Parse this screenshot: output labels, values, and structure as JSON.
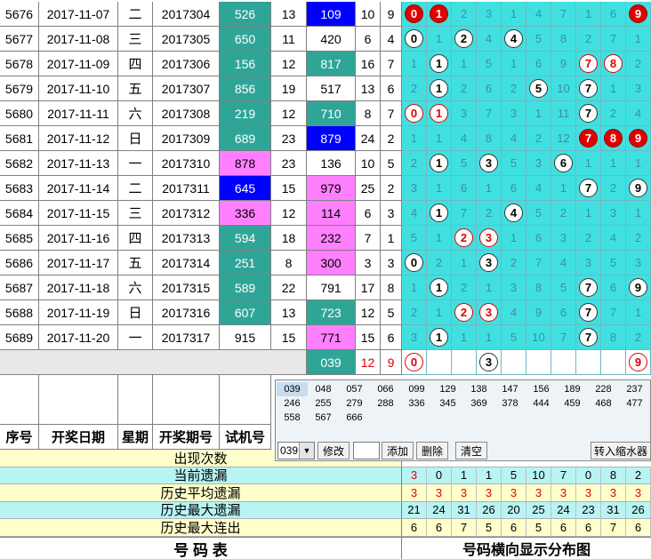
{
  "colors": {
    "teal": "#2fa597",
    "cyan_light": "#aef0f0",
    "blue": "#0000ff",
    "magenta": "#ff80ff",
    "yellow_light": "#ffffcc",
    "grid_bg": "#40e0e0",
    "grey": "#e8e8e8"
  },
  "rows": [
    {
      "seq": "5676",
      "date": "2017-11-07",
      "week": "二",
      "issue": "2017304",
      "trial": "526",
      "trial_bg": "teal",
      "sum": "13",
      "v1": "109",
      "v1_bg": "blue",
      "a": "10",
      "b": "9",
      "dist": [
        [
          "0",
          "red"
        ],
        [
          "1",
          "red"
        ],
        [
          "2",
          ""
        ],
        [
          "3",
          ""
        ],
        [
          "1",
          ""
        ],
        [
          "4",
          ""
        ],
        [
          "7",
          ""
        ],
        [
          "1",
          ""
        ],
        [
          "6",
          ""
        ],
        [
          "9",
          "red"
        ]
      ]
    },
    {
      "seq": "5677",
      "date": "2017-11-08",
      "week": "三",
      "issue": "2017305",
      "trial": "650",
      "trial_bg": "teal",
      "sum": "11",
      "v1": "420",
      "v1_bg": "",
      "a": "6",
      "b": "4",
      "dist": [
        [
          "0",
          "white"
        ],
        [
          "1",
          ""
        ],
        [
          "2",
          "white"
        ],
        [
          "4",
          ""
        ],
        [
          "4",
          "white"
        ],
        [
          "5",
          ""
        ],
        [
          "8",
          ""
        ],
        [
          "2",
          ""
        ],
        [
          "7",
          ""
        ],
        [
          "1",
          ""
        ]
      ]
    },
    {
      "seq": "5678",
      "date": "2017-11-09",
      "week": "四",
      "issue": "2017306",
      "trial": "156",
      "trial_bg": "teal",
      "sum": "12",
      "v1": "817",
      "v1_bg": "teal",
      "a": "16",
      "b": "7",
      "dist": [
        [
          "1",
          ""
        ],
        [
          "1",
          "white"
        ],
        [
          "1",
          ""
        ],
        [
          "5",
          ""
        ],
        [
          "1",
          ""
        ],
        [
          "6",
          ""
        ],
        [
          "9",
          ""
        ],
        [
          "7",
          "redring"
        ],
        [
          "8",
          "redring"
        ],
        [
          "2",
          ""
        ]
      ]
    },
    {
      "seq": "5679",
      "date": "2017-11-10",
      "week": "五",
      "issue": "2017307",
      "trial": "856",
      "trial_bg": "teal",
      "sum": "19",
      "v1": "517",
      "v1_bg": "",
      "a": "13",
      "b": "6",
      "dist": [
        [
          "2",
          ""
        ],
        [
          "1",
          "white"
        ],
        [
          "2",
          ""
        ],
        [
          "6",
          ""
        ],
        [
          "2",
          ""
        ],
        [
          "5",
          "white"
        ],
        [
          "10",
          ""
        ],
        [
          "7",
          "white"
        ],
        [
          "1",
          ""
        ],
        [
          "3",
          ""
        ]
      ]
    },
    {
      "seq": "5680",
      "date": "2017-11-11",
      "week": "六",
      "issue": "2017308",
      "trial": "219",
      "trial_bg": "teal",
      "sum": "12",
      "v1": "710",
      "v1_bg": "teal",
      "a": "8",
      "b": "7",
      "dist": [
        [
          "0",
          "redring"
        ],
        [
          "1",
          "redring"
        ],
        [
          "3",
          ""
        ],
        [
          "7",
          ""
        ],
        [
          "3",
          ""
        ],
        [
          "1",
          ""
        ],
        [
          "11",
          ""
        ],
        [
          "7",
          "white"
        ],
        [
          "2",
          ""
        ],
        [
          "4",
          ""
        ]
      ]
    },
    {
      "seq": "5681",
      "date": "2017-11-12",
      "week": "日",
      "issue": "2017309",
      "trial": "689",
      "trial_bg": "teal",
      "sum": "23",
      "v1": "879",
      "v1_bg": "blue",
      "a": "24",
      "b": "2",
      "dist": [
        [
          "1",
          ""
        ],
        [
          "1",
          ""
        ],
        [
          "4",
          ""
        ],
        [
          "8",
          ""
        ],
        [
          "4",
          ""
        ],
        [
          "2",
          ""
        ],
        [
          "12",
          ""
        ],
        [
          "7",
          "red"
        ],
        [
          "8",
          "red"
        ],
        [
          "9",
          "red"
        ]
      ]
    },
    {
      "seq": "5682",
      "date": "2017-11-13",
      "week": "一",
      "issue": "2017310",
      "trial": "878",
      "trial_bg": "magenta",
      "sum": "23",
      "v1": "136",
      "v1_bg": "",
      "a": "10",
      "b": "5",
      "dist": [
        [
          "2",
          ""
        ],
        [
          "1",
          "white"
        ],
        [
          "5",
          ""
        ],
        [
          "3",
          "white"
        ],
        [
          "5",
          ""
        ],
        [
          "3",
          ""
        ],
        [
          "6",
          "white"
        ],
        [
          "1",
          ""
        ],
        [
          "1",
          ""
        ],
        [
          "1",
          ""
        ]
      ]
    },
    {
      "seq": "5683",
      "date": "2017-11-14",
      "week": "二",
      "issue": "2017311",
      "trial": "645",
      "trial_bg": "blue",
      "sum": "15",
      "v1": "979",
      "v1_bg": "magenta",
      "a": "25",
      "b": "2",
      "dist": [
        [
          "3",
          ""
        ],
        [
          "1",
          ""
        ],
        [
          "6",
          ""
        ],
        [
          "1",
          ""
        ],
        [
          "6",
          ""
        ],
        [
          "4",
          ""
        ],
        [
          "1",
          ""
        ],
        [
          "7",
          "white"
        ],
        [
          "2",
          ""
        ],
        [
          "9",
          "white"
        ]
      ]
    },
    {
      "seq": "5684",
      "date": "2017-11-15",
      "week": "三",
      "issue": "2017312",
      "trial": "336",
      "trial_bg": "magenta",
      "sum": "12",
      "v1": "114",
      "v1_bg": "magenta",
      "a": "6",
      "b": "3",
      "dist": [
        [
          "4",
          ""
        ],
        [
          "1",
          "white"
        ],
        [
          "7",
          ""
        ],
        [
          "2",
          ""
        ],
        [
          "4",
          "white"
        ],
        [
          "5",
          ""
        ],
        [
          "2",
          ""
        ],
        [
          "1",
          ""
        ],
        [
          "3",
          ""
        ],
        [
          "1",
          ""
        ]
      ]
    },
    {
      "seq": "5685",
      "date": "2017-11-16",
      "week": "四",
      "issue": "2017313",
      "trial": "594",
      "trial_bg": "teal",
      "sum": "18",
      "v1": "232",
      "v1_bg": "magenta",
      "a": "7",
      "b": "1",
      "dist": [
        [
          "5",
          ""
        ],
        [
          "1",
          ""
        ],
        [
          "2",
          "redring"
        ],
        [
          "3",
          "redring"
        ],
        [
          "1",
          ""
        ],
        [
          "6",
          ""
        ],
        [
          "3",
          ""
        ],
        [
          "2",
          ""
        ],
        [
          "4",
          ""
        ],
        [
          "2",
          ""
        ]
      ]
    },
    {
      "seq": "5686",
      "date": "2017-11-17",
      "week": "五",
      "issue": "2017314",
      "trial": "251",
      "trial_bg": "teal",
      "sum": "8",
      "v1": "300",
      "v1_bg": "magenta",
      "a": "3",
      "b": "3",
      "dist": [
        [
          "0",
          "white"
        ],
        [
          "2",
          ""
        ],
        [
          "1",
          ""
        ],
        [
          "3",
          "white"
        ],
        [
          "2",
          ""
        ],
        [
          "7",
          ""
        ],
        [
          "4",
          ""
        ],
        [
          "3",
          ""
        ],
        [
          "5",
          ""
        ],
        [
          "3",
          ""
        ]
      ]
    },
    {
      "seq": "5687",
      "date": "2017-11-18",
      "week": "六",
      "issue": "2017315",
      "trial": "589",
      "trial_bg": "teal",
      "sum": "22",
      "v1": "791",
      "v1_bg": "",
      "a": "17",
      "b": "8",
      "dist": [
        [
          "1",
          ""
        ],
        [
          "1",
          "white"
        ],
        [
          "2",
          ""
        ],
        [
          "1",
          ""
        ],
        [
          "3",
          ""
        ],
        [
          "8",
          ""
        ],
        [
          "5",
          ""
        ],
        [
          "7",
          "white"
        ],
        [
          "6",
          ""
        ],
        [
          "9",
          "white"
        ]
      ]
    },
    {
      "seq": "5688",
      "date": "2017-11-19",
      "week": "日",
      "issue": "2017316",
      "trial": "607",
      "trial_bg": "teal",
      "sum": "13",
      "v1": "723",
      "v1_bg": "teal",
      "a": "12",
      "b": "5",
      "dist": [
        [
          "2",
          ""
        ],
        [
          "1",
          ""
        ],
        [
          "2",
          "redring"
        ],
        [
          "3",
          "redring"
        ],
        [
          "4",
          ""
        ],
        [
          "9",
          ""
        ],
        [
          "6",
          ""
        ],
        [
          "7",
          "white"
        ],
        [
          "7",
          ""
        ],
        [
          "1",
          ""
        ]
      ]
    },
    {
      "seq": "5689",
      "date": "2017-11-20",
      "week": "一",
      "issue": "2017317",
      "trial": "915",
      "trial_bg": "",
      "sum": "15",
      "v1": "771",
      "v1_bg": "magenta",
      "a": "15",
      "b": "6",
      "dist": [
        [
          "3",
          ""
        ],
        [
          "1",
          "white"
        ],
        [
          "1",
          ""
        ],
        [
          "1",
          ""
        ],
        [
          "5",
          ""
        ],
        [
          "10",
          ""
        ],
        [
          "7",
          ""
        ],
        [
          "7",
          "white"
        ],
        [
          "8",
          ""
        ],
        [
          "2",
          ""
        ]
      ]
    }
  ],
  "pending": {
    "v1": "039",
    "a": "12",
    "b": "9",
    "dist": [
      [
        "0",
        "redring"
      ],
      [
        "",
        ""
      ],
      [
        "",
        ""
      ],
      [
        "3",
        "white"
      ],
      [
        "",
        ""
      ],
      [
        "",
        ""
      ],
      [
        "",
        ""
      ],
      [
        "",
        ""
      ],
      [
        "",
        ""
      ],
      [
        "9",
        "redring"
      ]
    ]
  },
  "headers": {
    "seq": "序号",
    "date": "开奖日期",
    "week": "星期",
    "issue": "开奖期号",
    "trial": "试机号"
  },
  "stats": {
    "labels": [
      "出现次数",
      "当前遗漏",
      "历史平均遗漏",
      "历史最大遗漏",
      "历史最大连出"
    ],
    "current_omit": [
      "3",
      "0",
      "1",
      "1",
      "5",
      "10",
      "7",
      "0",
      "8",
      "2"
    ],
    "avg_omit": [
      "3",
      "3",
      "3",
      "3",
      "3",
      "3",
      "3",
      "3",
      "3",
      "3"
    ],
    "max_omit": [
      "21",
      "24",
      "31",
      "26",
      "20",
      "25",
      "24",
      "23",
      "31",
      "26"
    ],
    "max_consec": [
      "6",
      "6",
      "7",
      "5",
      "6",
      "5",
      "6",
      "6",
      "7",
      "6"
    ]
  },
  "footer": {
    "left": "号  码  表",
    "right": "号码横向显示分布图"
  },
  "panel": {
    "numbers": [
      "039",
      "048",
      "057",
      "066",
      "099",
      "129",
      "138",
      "147",
      "156",
      "189",
      "228",
      "237",
      "246",
      "255",
      "279",
      "288",
      "336",
      "345",
      "369",
      "378",
      "444",
      "459",
      "468",
      "477",
      "558",
      "567",
      "666"
    ],
    "select_value": "039",
    "buttons": {
      "modify": "修改",
      "add": "添加",
      "delete": "删除",
      "clear": "清空",
      "shrink": "转入缩水器"
    }
  }
}
